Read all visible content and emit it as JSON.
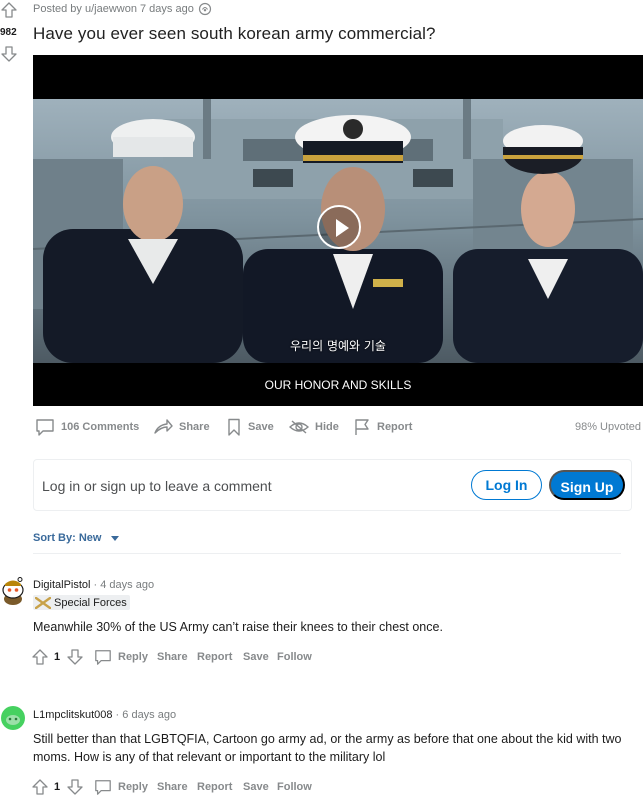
{
  "post": {
    "vote_count": "982",
    "meta": "Posted by u/jaewwon 7 days ago",
    "title": "Have you ever seen south korean army commercial?",
    "video": {
      "subtitle_kr": "우리의 명예와 기술",
      "subtitle_en": "OUR HONOR AND SKILLS"
    },
    "actions": {
      "comments": "106 Comments",
      "share": "Share",
      "save": "Save",
      "hide": "Hide",
      "report": "Report",
      "upvoted": "98% Upvoted"
    }
  },
  "comment_box": {
    "prompt": "Log in or sign up to leave a comment",
    "login_label": "Log In",
    "signup_label": "Sign Up"
  },
  "sort": {
    "label": "Sort By: New"
  },
  "comments": [
    {
      "author": "DigitalPistol",
      "time": " · 4 days ago",
      "flair": "Special Forces",
      "body": "Meanwhile 30% of the US Army can’t raise their knees to their chest once.",
      "votes": "1",
      "reply": "Reply",
      "share": "Share",
      "report": "Report",
      "save": "Save",
      "follow": "Follow"
    },
    {
      "author": "L1mpclitskut008",
      "time": " · 6 days ago",
      "body": "Still better than that LGBTQFIA, Cartoon go army ad, or the army as before that one about the kid with two moms. How is any of that relevant or important to the military lol",
      "votes": "1",
      "reply": "Reply",
      "share": "Share",
      "report": "Report",
      "save": "Save",
      "follow": "Follow"
    }
  ],
  "colors": {
    "accent": "#0079d3",
    "muted": "#878a8c",
    "sort_link": "#3a6a9b",
    "avatar_green": "#46d160"
  }
}
